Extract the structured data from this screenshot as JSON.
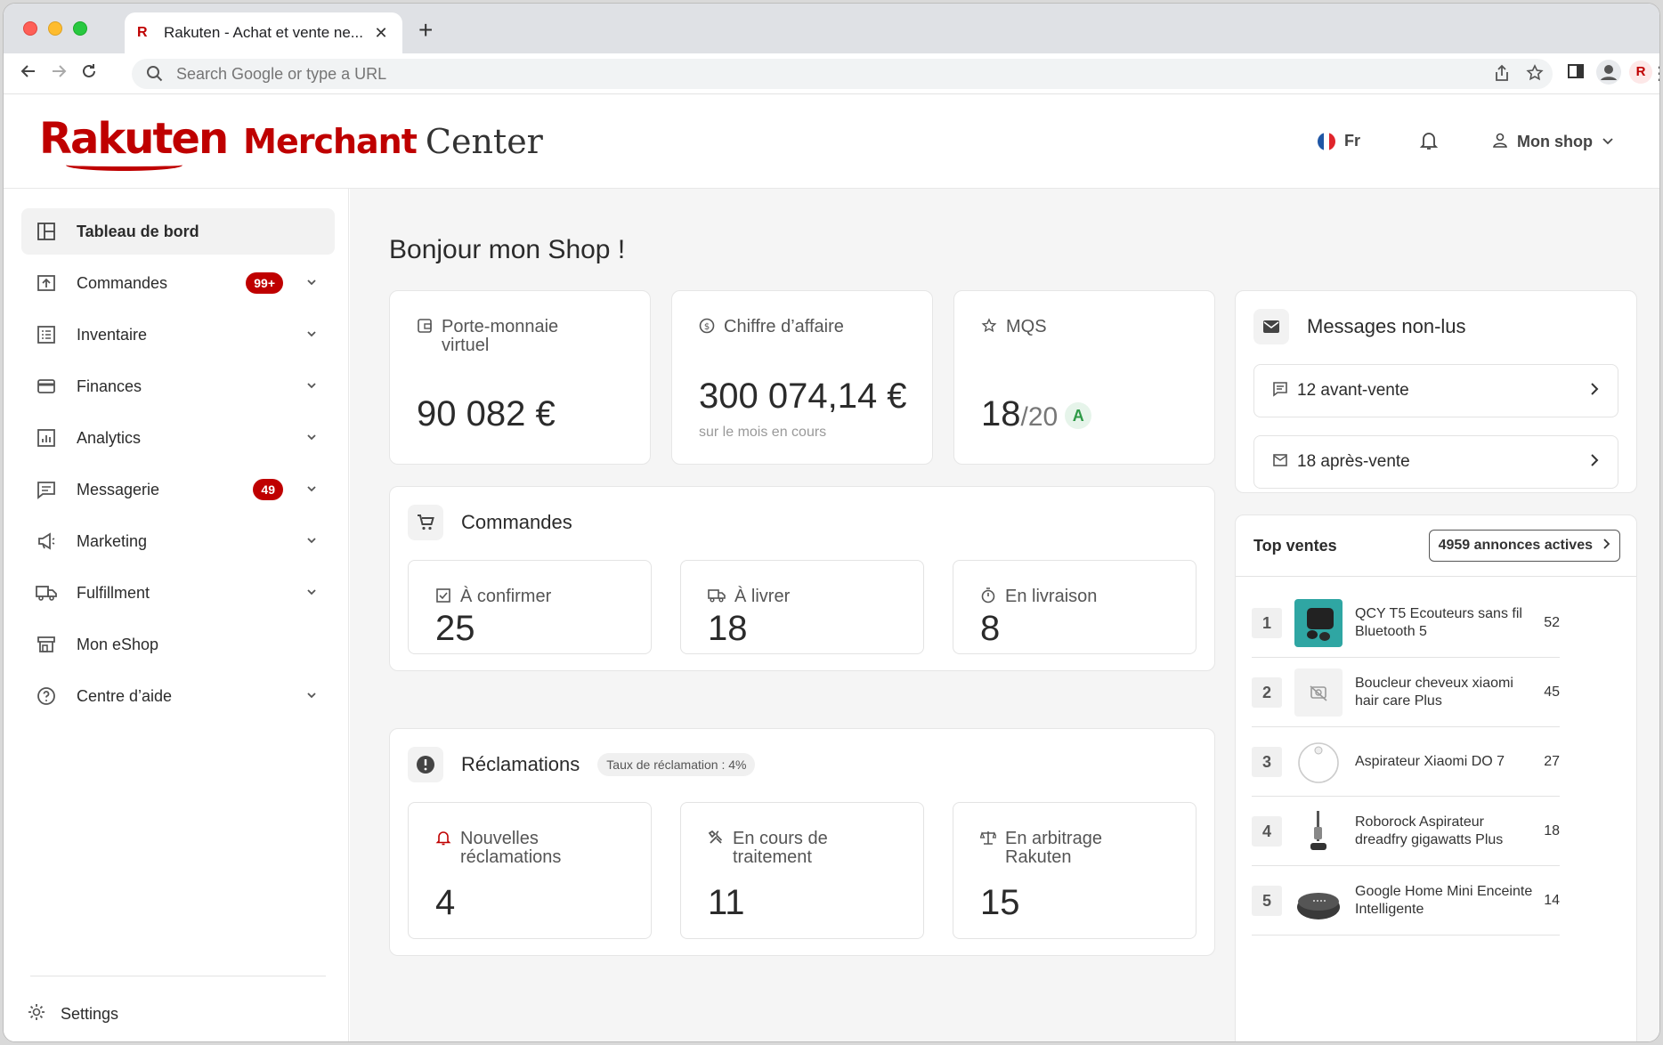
{
  "browser": {
    "tab_title": "Rakuten - Achat et vente ne...",
    "tab_favicon": "R",
    "address_placeholder": "Search Google or type a URL",
    "profile_initial": "R"
  },
  "header": {
    "logo_rakuten": "Rakuten",
    "logo_merchant": "Merchant",
    "logo_center": "Center",
    "language": "Fr",
    "account": "Mon shop"
  },
  "sidebar": {
    "items": [
      {
        "label": "Tableau de bord",
        "icon": "dashboard-icon"
      },
      {
        "label": "Commandes",
        "icon": "orders-icon",
        "badge": "99+"
      },
      {
        "label": "Inventaire",
        "icon": "inventory-icon"
      },
      {
        "label": "Finances",
        "icon": "wallet-icon"
      },
      {
        "label": "Analytics",
        "icon": "analytics-icon"
      },
      {
        "label": "Messagerie",
        "icon": "message-icon",
        "badge": "49"
      },
      {
        "label": "Marketing",
        "icon": "megaphone-icon"
      },
      {
        "label": "Fulfillment",
        "icon": "truck-icon"
      },
      {
        "label": "Mon eShop",
        "icon": "store-icon"
      },
      {
        "label": "Centre d’aide",
        "icon": "help-icon"
      }
    ],
    "settings": "Settings"
  },
  "main": {
    "greeting": "Bonjour mon Shop !",
    "wallet": {
      "title": "Porte-monnaie virtuel",
      "value": "90 082 €"
    },
    "revenue": {
      "title": "Chiffre d’affaire",
      "value": "300 074,14 €",
      "sub": "sur le mois en cours"
    },
    "mqs": {
      "title": "MQS",
      "value": "18",
      "denominator": "/20",
      "grade": "A"
    },
    "orders": {
      "title": "Commandes",
      "items": [
        {
          "label": "À confirmer",
          "value": "25"
        },
        {
          "label": "À livrer",
          "value": "18"
        },
        {
          "label": "En livraison",
          "value": "8"
        }
      ]
    },
    "claims": {
      "title": "Réclamations",
      "rate": "Taux de réclamation : 4%",
      "items": [
        {
          "label": "Nouvelles réclamations",
          "value": "4"
        },
        {
          "label": "En cours de traitement",
          "value": "11"
        },
        {
          "label": "En arbitrage Rakuten",
          "value": "15"
        }
      ]
    },
    "messages": {
      "title": "Messages non-lus",
      "items": [
        {
          "label": "12 avant-vente"
        },
        {
          "label": "18 après-vente"
        }
      ]
    },
    "top_sales": {
      "title": "Top ventes",
      "active_button": "4959 annonces actives",
      "items": [
        {
          "rank": "1",
          "name": "QCY T5 Ecouteurs sans fil Bluetooth 5",
          "count": "52"
        },
        {
          "rank": "2",
          "name": "Boucleur cheveux xiaomi hair care Plus",
          "count": "45"
        },
        {
          "rank": "3",
          "name": "Aspirateur Xiaomi DO 7",
          "count": "27"
        },
        {
          "rank": "4",
          "name": "Roborock Aspirateur dreadfry gigawatts Plus",
          "count": "18"
        },
        {
          "rank": "5",
          "name": "Google Home Mini Enceinte Intelligente",
          "count": "14"
        }
      ]
    }
  },
  "colors": {
    "brand": "#bf0000",
    "grade_green": "#2e9a47",
    "background": "#f5f5f5"
  }
}
